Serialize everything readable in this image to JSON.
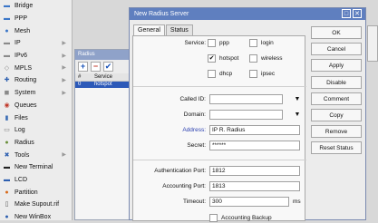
{
  "menu": {
    "items": [
      {
        "label": "Bridge",
        "icon": "bridge-icon",
        "glyph": "▬",
        "color": "#3a76c8",
        "has_arrow": false
      },
      {
        "label": "PPP",
        "icon": "ppp-icon",
        "glyph": "▬",
        "color": "#3a76c8",
        "has_arrow": false
      },
      {
        "label": "Mesh",
        "icon": "mesh-icon",
        "glyph": "●",
        "color": "#3a76c8",
        "has_arrow": false
      },
      {
        "label": "IP",
        "icon": "ip-icon",
        "glyph": "▬",
        "color": "#8a8a8a",
        "has_arrow": true
      },
      {
        "label": "IPv6",
        "icon": "ipv6-icon",
        "glyph": "▬",
        "color": "#8a8a8a",
        "has_arrow": true
      },
      {
        "label": "MPLS",
        "icon": "mpls-icon",
        "glyph": "◇",
        "color": "#8a8a8a",
        "has_arrow": true
      },
      {
        "label": "Routing",
        "icon": "routing-icon",
        "glyph": "✚",
        "color": "#2d5fb0",
        "has_arrow": true
      },
      {
        "label": "System",
        "icon": "system-icon",
        "glyph": "◼",
        "color": "#8a8a8a",
        "has_arrow": true
      },
      {
        "label": "Queues",
        "icon": "queues-icon",
        "glyph": "◉",
        "color": "#c0392b",
        "has_arrow": false
      },
      {
        "label": "Files",
        "icon": "files-icon",
        "glyph": "▮",
        "color": "#3b6db5",
        "has_arrow": false
      },
      {
        "label": "Log",
        "icon": "log-icon",
        "glyph": "▭",
        "color": "#7a7a7a",
        "has_arrow": false
      },
      {
        "label": "Radius",
        "icon": "radius-icon",
        "glyph": "●",
        "color": "#6a8f3a",
        "has_arrow": false
      },
      {
        "label": "Tools",
        "icon": "tools-icon",
        "glyph": "✖",
        "color": "#2d5fb0",
        "has_arrow": true
      },
      {
        "label": "New Terminal",
        "icon": "terminal-icon",
        "glyph": "▬",
        "color": "#222222",
        "has_arrow": false
      },
      {
        "label": "LCD",
        "icon": "lcd-icon",
        "glyph": "▬",
        "color": "#2d5fb0",
        "has_arrow": false
      },
      {
        "label": "Partition",
        "icon": "partition-icon",
        "glyph": "●",
        "color": "#d86a1a",
        "has_arrow": false
      },
      {
        "label": "Make Supout.rif",
        "icon": "supout-icon",
        "glyph": "▯",
        "color": "#555555",
        "has_arrow": false
      },
      {
        "label": "New WinBox",
        "icon": "winbox-icon",
        "glyph": "●",
        "color": "#2d5fb0",
        "has_arrow": false
      }
    ]
  },
  "radius_list": {
    "title": "Radius",
    "columns": [
      "#",
      "Service"
    ],
    "rows": [
      {
        "num": "0",
        "service": "hotspot"
      }
    ],
    "add_label": "+",
    "remove_label": "−",
    "enable_label": "✔"
  },
  "dialog": {
    "title": "New Radius Server",
    "restore_glyph": "□",
    "close_glyph": "✕",
    "tabs": [
      "General",
      "Status"
    ],
    "service_label": "Service:",
    "services": [
      {
        "label": "ppp",
        "checked": false
      },
      {
        "label": "login",
        "checked": false
      },
      {
        "label": "hotspot",
        "checked": true
      },
      {
        "label": "wireless",
        "checked": false
      },
      {
        "label": "dhcp",
        "checked": false
      },
      {
        "label": "ipsec",
        "checked": false
      }
    ],
    "check_mark": "✔",
    "dropdown_glyph": "▼",
    "called_id_label": "Called ID:",
    "called_id_value": "",
    "domain_label": "Domain:",
    "domain_value": "",
    "address_label": "Address:",
    "address_value": "IP R. Radius",
    "secret_label": "Secret:",
    "secret_value": "******",
    "auth_port_label": "Authentication Port:",
    "auth_port_value": "1812",
    "acct_port_label": "Accounting Port:",
    "acct_port_value": "1813",
    "timeout_label": "Timeout:",
    "timeout_value": "300",
    "timeout_unit": "ms",
    "accounting_backup_label": "Accounting Backup",
    "accounting_backup_checked": false,
    "buttons": [
      "OK",
      "Cancel",
      "Apply",
      "Disable",
      "Comment",
      "Copy",
      "Remove",
      "Reset Status"
    ]
  },
  "colors": {
    "title_bar": "#5f7fbf",
    "selection": "#2c59b8",
    "link": "#2a3fb0"
  }
}
